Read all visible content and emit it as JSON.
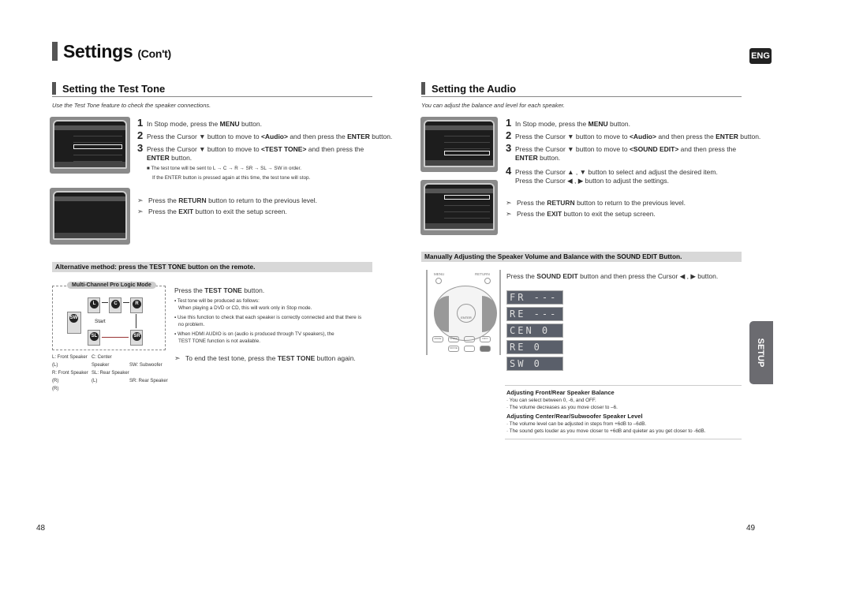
{
  "header": {
    "title": "Settings",
    "title_suffix": "(Con't)",
    "lang_badge": "ENG"
  },
  "left": {
    "section_title": "Setting the Test Tone",
    "intro": "Use the Test Tone feature to check the speaker connections.",
    "steps": [
      {
        "num": "1",
        "pre": "In Stop mode, press the ",
        "bold": "MENU",
        "post": " button."
      },
      {
        "num": "2",
        "pre": "Press the Cursor ▼ button to move to ",
        "bold": "<Audio>",
        "mid": " and then press the ",
        "bold2": "ENTER",
        "post": " button."
      },
      {
        "num": "3",
        "pre": "Press the Cursor ▼ button to move to ",
        "bold": "<TEST TONE>",
        "post": " and then press the",
        "line2_bold": "ENTER",
        "line2_post": " button."
      }
    ],
    "notes": [
      "■  The test tone will be sent to L → C → R → SR → SL → SW in order.",
      "If the ENTER button is pressed again at this time, the test tone will stop."
    ],
    "tips": [
      {
        "pre": "Press the ",
        "bold": "RETURN",
        "post": " button to return to the previous level."
      },
      {
        "pre": "Press the ",
        "bold": "EXIT",
        "post": " button to exit the setup screen."
      }
    ],
    "alt_bar": "Alternative method: press the TEST TONE button on the remote.",
    "diagram": {
      "title": "Multi-Channel Pro Logic Mode",
      "start_label": "Start",
      "speakers": [
        "L",
        "C",
        "R",
        "SW",
        "SL",
        "SR"
      ],
      "legend": [
        [
          "L: Front Speaker (L)",
          "C: Center Speaker",
          "SW: Subwoofer"
        ],
        [
          "R: Front Speaker (R)",
          "SL: Rear Speaker (L)",
          "SR: Rear Speaker (R)"
        ]
      ]
    },
    "alt": {
      "lead_pre": "Press the ",
      "lead_bold": "TEST TONE",
      "lead_post": " button.",
      "bullets": [
        [
          "Test tone will be produced as follows:",
          "When playing a DVD or CD, this will work only in Stop mode."
        ],
        [
          "Use this function to check that each speaker is correctly connected and that there is",
          "no problem."
        ],
        [
          "When HDMI AUDIO is on (audio is produced through TV speakers), the",
          "TEST TONE function is not available."
        ]
      ],
      "tip_pre": "To end the test tone, press the ",
      "tip_bold": "TEST TONE",
      "tip_post": " button again."
    },
    "page_number": "48"
  },
  "right": {
    "section_title": "Setting the Audio",
    "intro": "You can adjust the balance and level for each speaker.",
    "steps": [
      {
        "num": "1",
        "pre": "In Stop mode, press the ",
        "bold": "MENU",
        "post": " button."
      },
      {
        "num": "2",
        "pre": "Press the Cursor ▼ button to move to ",
        "bold": "<Audio>",
        "mid": " and then press the ",
        "bold2": "ENTER",
        "post": " button."
      },
      {
        "num": "3",
        "pre": "Press the Cursor ▼ button to move to ",
        "bold": "<SOUND EDIT>",
        "post": " and then press the",
        "line2_bold": "ENTER",
        "line2_post": " button."
      },
      {
        "num": "4",
        "pre": "Press the Cursor ▲ , ▼ button to select and adjust the desired item.",
        "line2": "Press the Cursor ◀ , ▶ button to adjust the settings."
      }
    ],
    "tips": [
      {
        "pre": "Press the ",
        "bold": "RETURN",
        "post": " button to return to the previous level."
      },
      {
        "pre": "Press the ",
        "bold": "EXIT",
        "post": " button to exit the setup screen."
      }
    ],
    "manual_bar": "Manually Adjusting the Speaker Volume and Balance with the SOUND EDIT Button.",
    "manual_lead_pre": "Press the ",
    "manual_lead_bold": "SOUND EDIT",
    "manual_lead_post": " button and then press the Cursor ◀ , ▶ button.",
    "remote": {
      "menu": "MENU",
      "return": "RETURN",
      "enter": "ENTER",
      "buttons": [
        "MODE",
        "SPEED",
        "INFO",
        "SLOW",
        "TEST TONE",
        "SOUND EDIT",
        "MONO",
        "MOVIE"
      ]
    },
    "lcd": [
      "FR ---◇---",
      "RE ---◇---",
      "CEN  0",
      "RE   0",
      "SW   0"
    ],
    "balance_title": "Adjusting Front/Rear Speaker Balance",
    "balance_bullets": [
      "· You can select between 0, -6, and OFF.",
      "· The volume decreases as you move closer to –6."
    ],
    "level_title": "Adjusting Center/Rear/Subwoofer Speaker Level",
    "level_bullets": [
      "· The volume level can be adjusted in steps from +6dB to –6dB.",
      "· The sound gets louder as you move closer to +6dB and quieter as you get closer to -6dB."
    ],
    "side_tab": "SETUP",
    "page_number": "49"
  }
}
